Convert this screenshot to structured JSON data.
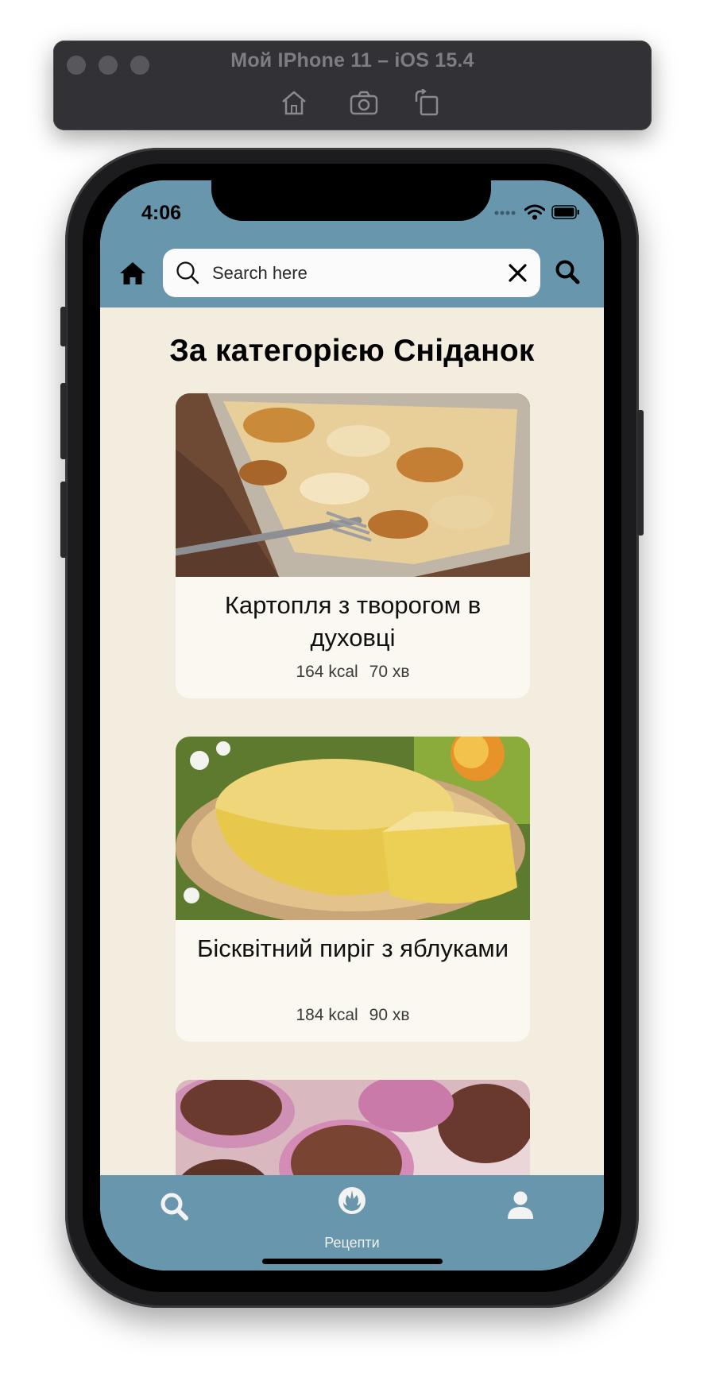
{
  "simulator": {
    "title": "Мой IPhone 11 – iOS 15.4",
    "tools": [
      "home-icon",
      "screenshot-icon",
      "rotate-icon"
    ]
  },
  "status_bar": {
    "time": "4:06",
    "icons": [
      "cellular-icon",
      "wifi-icon",
      "battery-icon"
    ]
  },
  "header": {
    "search_placeholder": "Search here",
    "search_value": ""
  },
  "page": {
    "title": "За категорією Сніданок"
  },
  "recipes": [
    {
      "title": "Картопля з творогом в духовці",
      "calories": "164 kcal",
      "time": "70 хв"
    },
    {
      "title": "Бісквітний пиріг з яблуками",
      "calories": "184 kcal",
      "time": "90 хв"
    },
    {
      "title": "",
      "calories": "",
      "time": ""
    }
  ],
  "tabs": [
    {
      "icon": "search-icon",
      "label": ""
    },
    {
      "icon": "rebel-alliance-icon",
      "label": "Рецепти"
    },
    {
      "icon": "user-icon",
      "label": ""
    }
  ],
  "colors": {
    "header_bg": "#6796ad",
    "content_bg": "#f3ede0",
    "card_bg": "#fbf8f1",
    "simulator_bar": "#323236"
  }
}
